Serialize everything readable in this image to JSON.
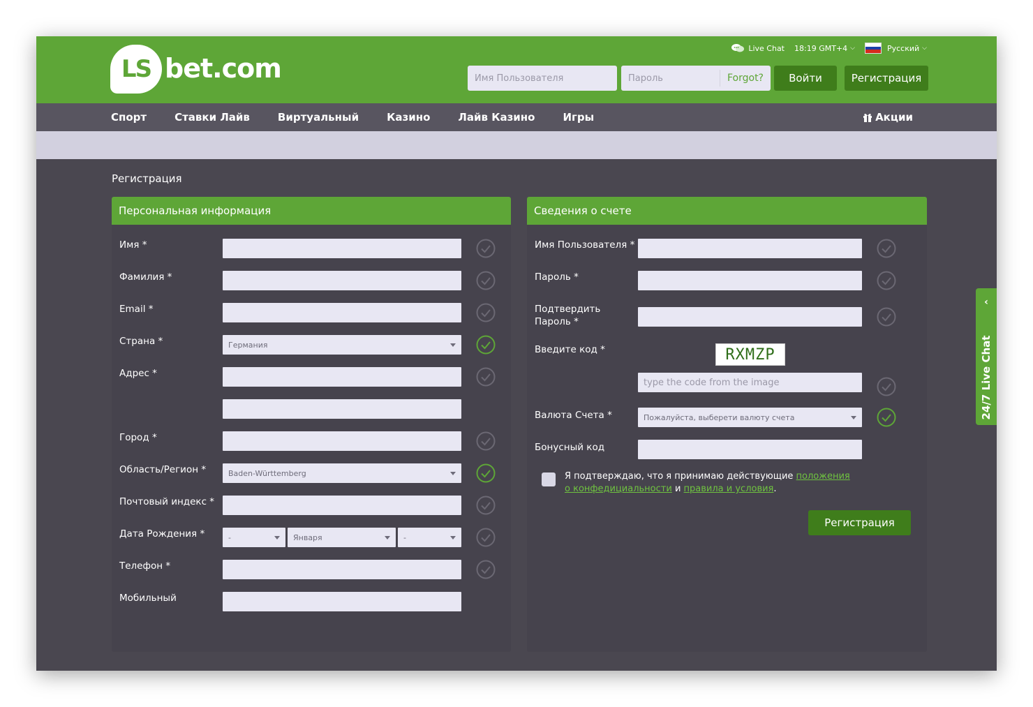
{
  "header": {
    "logo_badge": "LS",
    "logo_text": "bet.com",
    "live_chat": "Live Chat",
    "time": "18:19 GMT+4",
    "language": "Русский",
    "username_placeholder": "Имя Пользователя",
    "password_placeholder": "Пароль",
    "forgot": "Forgot?",
    "login_button": "Войти",
    "register_button": "Регистрация"
  },
  "nav": {
    "items": [
      "Спорт",
      "Ставки Лайв",
      "Виртуальный",
      "Казино",
      "Лайв Казино",
      "Игры"
    ],
    "promo": "Акции"
  },
  "page": {
    "title": "Регистрация"
  },
  "personal": {
    "title": "Персональная информация",
    "first_name": "Имя *",
    "last_name": "Фамилия *",
    "email": "Email *",
    "country": "Страна *",
    "country_value": "Германия",
    "address": "Адрес *",
    "city": "Город *",
    "region": "Область/Регион *",
    "region_value": "Baden-Württemberg",
    "postcode": "Почтовый индекс *",
    "birthdate": "Дата Рождения *",
    "birth_day": "-",
    "birth_month": "Января",
    "birth_year": "-",
    "phone": "Телефон *",
    "mobile": "Мобильный"
  },
  "account": {
    "title": "Сведения о счете",
    "username": "Имя Пользователя *",
    "password": "Пароль *",
    "confirm_password": "Подтвердить Пароль *",
    "captcha_label": "Введите код *",
    "captcha_code": "RXMZP",
    "captcha_placeholder": "type the code from the image",
    "currency": "Валюта Счета *",
    "currency_value": "Пожалуйста, выберети валюту счета",
    "bonus": "Бонусный код",
    "agree_text_1": "Я подтверждаю, что я принимаю действующие ",
    "agree_link_1": "положения о конфедициальности",
    "agree_text_2": " и ",
    "agree_link_2": "правила и условия",
    "agree_text_3": ".",
    "submit": "Регистрация"
  },
  "live_tab": {
    "label": "24/7 Live Chat",
    "arrow": "‹"
  },
  "colors": {
    "brand_green": "#5ea637",
    "dark_green": "#3f7d1b",
    "panel_bg": "#46434d",
    "page_bg": "#4a4750",
    "nav_bg": "#585560"
  }
}
